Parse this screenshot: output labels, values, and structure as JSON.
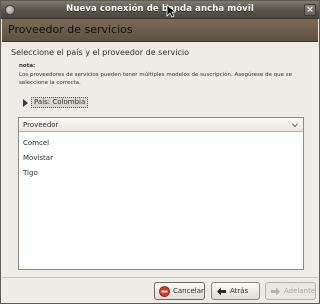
{
  "window": {
    "title": "Nueva conexión de banda ancha móvil"
  },
  "banner": {
    "title": "Proveedor de servicios"
  },
  "page": {
    "heading": "Seleccione el país y el proveedor de servicio",
    "note_label": "nota:",
    "note_text": "Los proveedores de servicios pueden tener múltiples modelos de suscripción. Asegúrese de que se seleccione la correcta.",
    "country_label": "País: Colombia"
  },
  "provider_list": {
    "header": "Proveedor",
    "items": [
      "Comcel",
      "Movistar",
      "Tigo"
    ]
  },
  "buttons": {
    "cancel": "Cancelar",
    "back": "Atrás",
    "forward": "Adelante"
  },
  "colors": {
    "banner": "#6d5e4a",
    "titlebar": "#5a554c",
    "window_bg": "#efebe7"
  }
}
